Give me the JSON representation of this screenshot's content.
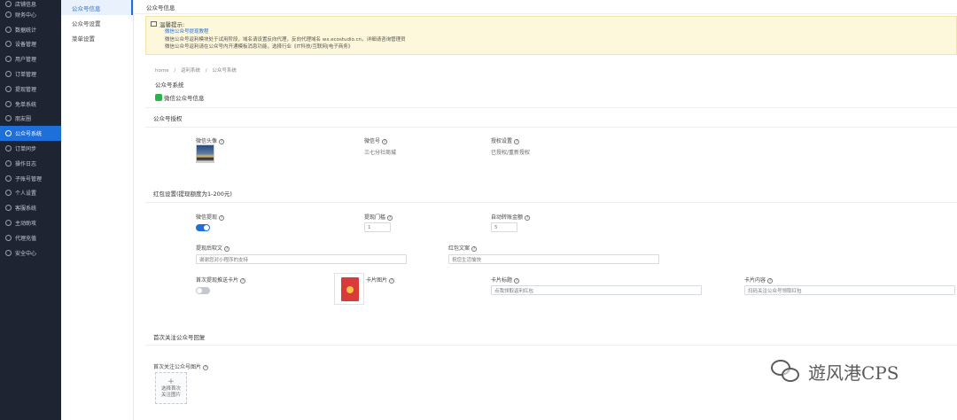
{
  "sidebar": {
    "items": [
      {
        "label": "店铺信息",
        "active": false
      },
      {
        "label": "财务中心",
        "active": false
      },
      {
        "label": "数据统计",
        "active": false
      },
      {
        "label": "设备管理",
        "active": false
      },
      {
        "label": "用户管理",
        "active": false
      },
      {
        "label": "订单管理",
        "active": false
      },
      {
        "label": "提现管理",
        "active": false
      },
      {
        "label": "免单系统",
        "active": false
      },
      {
        "label": "朋友圈",
        "active": false
      },
      {
        "label": "公众号系统",
        "active": true
      },
      {
        "label": "订单同步",
        "active": false
      },
      {
        "label": "操作日志",
        "active": false
      },
      {
        "label": "子账号管理",
        "active": false
      },
      {
        "label": "个人设置",
        "active": false
      },
      {
        "label": "客服系统",
        "active": false
      },
      {
        "label": "主动助攻",
        "active": false
      },
      {
        "label": "代理充值",
        "active": false
      },
      {
        "label": "安全中心",
        "active": false
      }
    ]
  },
  "subnav": {
    "items": [
      {
        "label": "公众号信息",
        "active": true
      },
      {
        "label": "公众号设置",
        "active": false
      },
      {
        "label": "菜单设置",
        "active": false
      }
    ]
  },
  "page": {
    "title": "公众号信息"
  },
  "notice": {
    "title": "温馨提示:",
    "link": "微信公众号提现教程",
    "line1": "微信公众号返利模块处于试用阶段，域名请设置反向代理，反向代理域名 wx.ecostudio.cn，详细请咨询管理员",
    "line2": "微信公众号返利请在公众号内开通模板消息功能，选择行业《IT科技/互联网|电子商务》"
  },
  "breadcrumb": {
    "home": "home",
    "sep": "/",
    "level1": "返利系统",
    "level2": "公众号系统"
  },
  "system_title": "公众号系统",
  "wx_tag": "微信公众号信息",
  "auth": {
    "section_title": "公众号授权",
    "avatar_label": "微信头像",
    "wxid_label": "微信号",
    "wxid_value": "三七分社商城",
    "status_label": "授权设置",
    "status_value": "已授权/重新授权"
  },
  "redpacket": {
    "section_title": "红包设置(提现额度为1-200元)",
    "wx_withdraw_label": "微信提现",
    "wx_withdraw_on": true,
    "threshold_label": "提现门槛",
    "threshold_value": "1",
    "auto_amount_label": "自动转账金额",
    "auto_amount_value": "5",
    "after_text_label": "提现后软文",
    "after_text_value": "谢谢您对小程序的支持",
    "red_text_label": "红包文案",
    "red_text_value": "祝您生活愉快",
    "first_push_label": "首次提现推送卡片",
    "first_push_on": false,
    "card_image_label": "卡片图片",
    "card_title_label": "卡片标题",
    "card_title_value": "点我领取返利红包",
    "card_content_label": "卡片内容",
    "card_content_value": "扫码关注公众号领取红包"
  },
  "follow": {
    "section_title": "首次关注公众号回复",
    "image_label": "首次关注公众号图片",
    "upload_plus": "+",
    "upload_line1": "选择首次",
    "upload_line2": "关注图片"
  },
  "watermark": {
    "text": "遊风港CPS"
  }
}
